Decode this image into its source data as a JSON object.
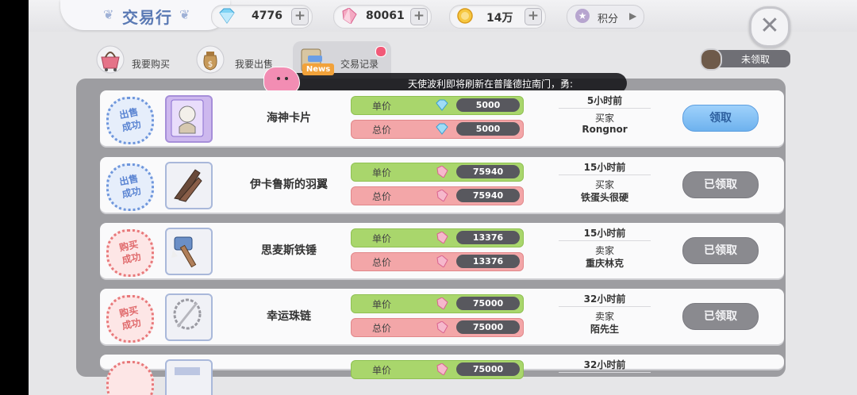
{
  "header": {
    "title": "交易行",
    "currencies": [
      {
        "icon": "diamond-icon",
        "value": "4776"
      },
      {
        "icon": "pink-crystal-icon",
        "value": "80061"
      },
      {
        "icon": "zeny-coin-icon",
        "value": "14万"
      }
    ],
    "points_label": "积分",
    "close_label": "✕"
  },
  "tabs": [
    {
      "label": "我要购买",
      "icon": "shopping-basket-icon"
    },
    {
      "label": "我要出售",
      "icon": "money-bag-icon"
    },
    {
      "label": "交易记录",
      "icon": "trade-record-icon"
    }
  ],
  "unclaimed_label": "未领取",
  "news": {
    "badge": "News",
    "text": "天使波利即将刷新在普隆德拉南门，勇:"
  },
  "price_labels": {
    "unit": "单价",
    "total": "总价"
  },
  "records": [
    {
      "stamp": "出售成功",
      "stamp_type": "sell",
      "item": "海神卡片",
      "item_icon": "poseidon-card-icon",
      "currency": "diamond",
      "unit": "5000",
      "total": "5000",
      "time": "5小时前",
      "role": "买家",
      "counterparty": "Rongnor",
      "button": "领取",
      "claimed": false
    },
    {
      "stamp": "出售成功",
      "stamp_type": "sell",
      "item": "伊卡鲁斯的羽翼",
      "item_icon": "icarus-wing-icon",
      "currency": "crystal",
      "unit": "75940",
      "total": "75940",
      "time": "15小时前",
      "role": "买家",
      "counterparty": "铁蛋头很硬",
      "button": "已领取",
      "claimed": true
    },
    {
      "stamp": "购买成功",
      "stamp_type": "buy",
      "item": "思麦斯铁锤",
      "item_icon": "hammer-icon",
      "currency": "crystal",
      "unit": "13376",
      "total": "13376",
      "time": "15小时前",
      "role": "卖家",
      "counterparty": "重庆林克",
      "button": "已领取",
      "claimed": true
    },
    {
      "stamp": "购买成功",
      "stamp_type": "buy",
      "item": "幸运珠链",
      "item_icon": "lucky-necklace-icon",
      "currency": "crystal",
      "unit": "75000",
      "total": "75000",
      "time": "32小时前",
      "role": "卖家",
      "counterparty": "陌先生",
      "button": "已领取",
      "claimed": true
    },
    {
      "stamp": "",
      "stamp_type": "buy",
      "item": "",
      "item_icon": "item-icon",
      "currency": "crystal",
      "unit": "75000",
      "total": "",
      "time": "32小时前",
      "role": "",
      "counterparty": "",
      "button": "",
      "claimed": true
    }
  ]
}
